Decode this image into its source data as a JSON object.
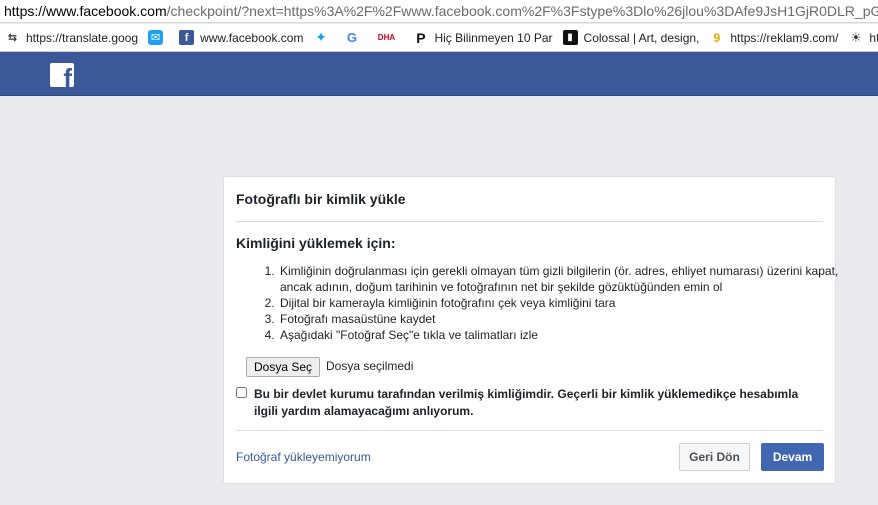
{
  "browser": {
    "url_domain": "https://www.facebook.com",
    "url_rest": "/checkpoint/?next=https%3A%2F%2Fwww.facebook.com%2F%3Fstype%3Dlo%26jlou%3DAfe9JsH1GjR0DLR_pGwT",
    "bookmarks": [
      {
        "label": "https://translate.goog",
        "icon": "translate-icon"
      },
      {
        "label": "",
        "icon": "tweetdeck-icon"
      },
      {
        "label": "www.facebook.com",
        "icon": "facebook-icon"
      },
      {
        "label": "",
        "icon": "twitter-icon"
      },
      {
        "label": "",
        "icon": "google-icon"
      },
      {
        "label": "",
        "icon": "dha-icon"
      },
      {
        "label": "Hiç Bilinmeyen 10 Par",
        "icon": "p-icon"
      },
      {
        "label": "Colossal | Art, design,",
        "icon": "colossal-icon"
      },
      {
        "label": "https://reklam9.com/",
        "icon": "reklam9-icon"
      },
      {
        "label": "htt",
        "icon": "sun-icon"
      }
    ]
  },
  "header": {
    "logo": "f"
  },
  "card": {
    "title": "Fotoğraflı bir kimlik yükle",
    "subtitle": "Kimliğini yüklemek için:",
    "steps": [
      "Kimliğinin doğrulanması için gerekli olmayan tüm gizli bilgilerin (ör. adres, ehliyet numarası) üzerini kapat, ancak adının, doğum tarihinin ve fotoğrafının net bir şekilde gözüktüğünden emin ol",
      "Dijital bir kamerayla kimliğinin fotoğrafını çek veya kimliğini tara",
      "Fotoğrafı masaüstüne kaydet",
      "Aşağıdaki \"Fotoğraf Seç\"e tıkla ve talimatları izle"
    ],
    "file_button": "Dosya Seç",
    "file_status": "Dosya seçilmedi",
    "checkbox_label": "Bu bir devlet kurumu tarafından verilmiş kimliğimdir. Geçerli bir kimlik yüklemedikçe hesabımla ilgili yardım alamayacağımı anlıyorum.",
    "cant_upload_link": "Fotoğraf yükleyemiyorum",
    "back_button": "Geri Dön",
    "continue_button": "Devam"
  },
  "colors": {
    "fb_blue": "#3b5998",
    "button_blue": "#4267b2",
    "page_bg": "#e9ebee",
    "link": "#365899"
  }
}
